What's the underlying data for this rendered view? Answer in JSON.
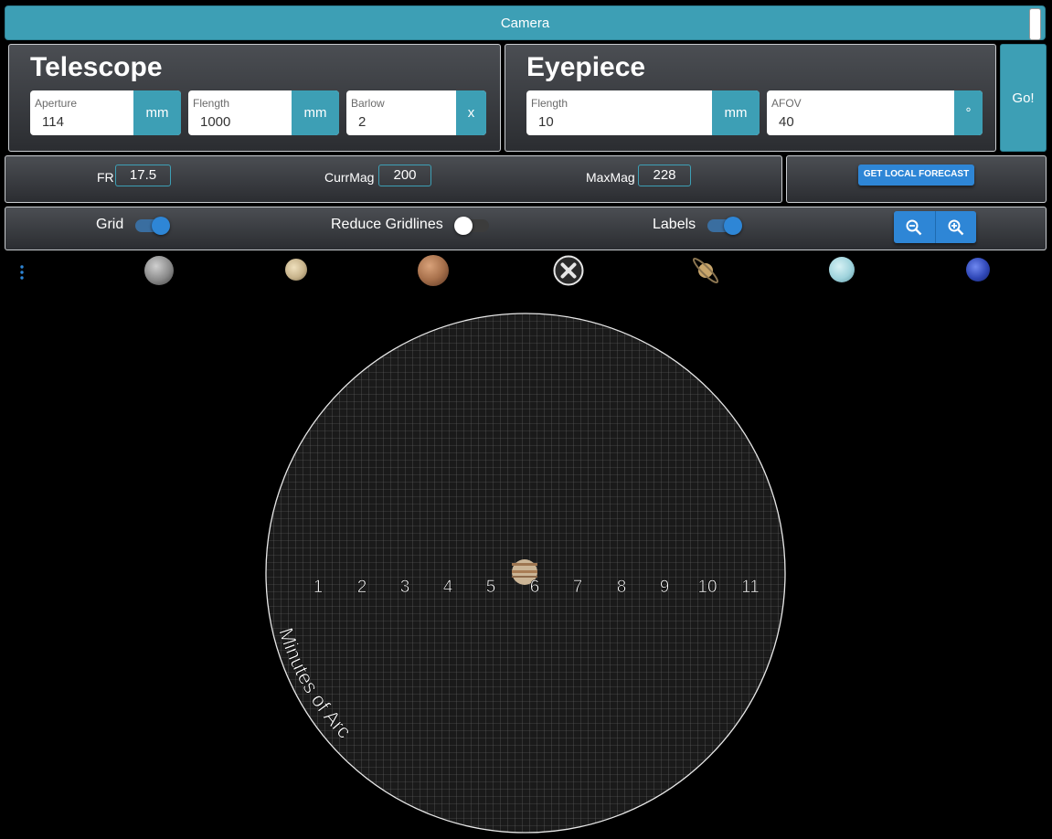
{
  "camera": {
    "label": "Camera"
  },
  "telescope": {
    "title": "Telescope",
    "fields": [
      {
        "label": "Aperture",
        "value": "114",
        "unit": "mm"
      },
      {
        "label": "Flength",
        "value": "1000",
        "unit": "mm"
      },
      {
        "label": "Barlow",
        "value": "2",
        "unit": "x"
      }
    ]
  },
  "eyepiece": {
    "title": "Eyepiece",
    "fields": [
      {
        "label": "Flength",
        "value": "10",
        "unit": "mm"
      },
      {
        "label": "AFOV",
        "value": "40",
        "unit": "°"
      }
    ]
  },
  "go_label": "Go!",
  "stats": [
    {
      "label": "FR",
      "value": "17.5"
    },
    {
      "label": "CurrMag",
      "value": "200"
    },
    {
      "label": "MaxMag",
      "value": "228"
    }
  ],
  "forecast_label": "GET LOCAL FORECAST",
  "toggles": [
    {
      "label": "Grid",
      "state": "on"
    },
    {
      "label": "Reduce Gridlines",
      "state": "off"
    },
    {
      "label": "Labels",
      "state": "on"
    }
  ],
  "zoom": {
    "out_icon": "zoom-out-icon",
    "in_icon": "zoom-in-icon"
  },
  "planets": [
    {
      "name": "mercury",
      "color": "#8c8c8c"
    },
    {
      "name": "venus",
      "color": "#c8b48c"
    },
    {
      "name": "mars",
      "color": "#a8714c"
    },
    {
      "name": "close",
      "color": "#ffffff"
    },
    {
      "name": "saturn",
      "color": "#c9a66b"
    },
    {
      "name": "uranus",
      "color": "#9fd3dc"
    },
    {
      "name": "neptune",
      "color": "#3048b8"
    }
  ],
  "view": {
    "scale_labels": [
      "1",
      "2",
      "3",
      "4",
      "5",
      "6",
      "7",
      "8",
      "9",
      "10",
      "11"
    ],
    "arc_label": "Minutes of Arc",
    "target": "jupiter"
  },
  "colors": {
    "accent": "#3d9fb5",
    "button_blue": "#2e86d6"
  }
}
